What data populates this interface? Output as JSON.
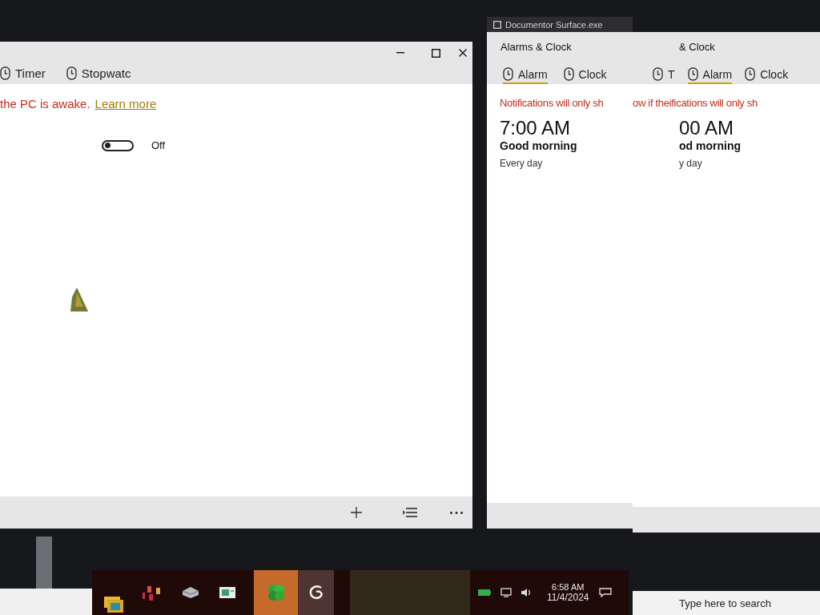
{
  "left_window": {
    "tabs": [
      {
        "label": "Timer",
        "selected": false
      },
      {
        "label": "Stopwatc",
        "selected": false
      }
    ],
    "notice": "the PC is awake.",
    "link": "Learn more",
    "toggle": {
      "on": false,
      "label": "Off"
    }
  },
  "preview_title": "Documentor Surface.exe",
  "right_window": {
    "title": "Alarms & Clock",
    "tabs": [
      {
        "label": "Alarm",
        "selected": true
      },
      {
        "label": "Clock",
        "selected": false
      }
    ],
    "notice": "Notifications will only sh",
    "alarm": {
      "time": "7:00 AM",
      "name": "Good morning",
      "repeat": "Every day"
    }
  },
  "right_copy": {
    "title": "& Clock",
    "tabs": [
      {
        "label": "T",
        "selected": false
      },
      {
        "label": "Alarm",
        "selected": true
      },
      {
        "label": "Clock",
        "selected": false
      }
    ],
    "notice": "ow if theifications will only sh",
    "alarm": {
      "time": "00 AM",
      "name": "od morning",
      "repeat": "y day"
    }
  },
  "taskbar": {
    "time": "6:58 AM",
    "date": "11/4/2024",
    "search": {
      "placeholder": "Type here to search"
    }
  }
}
